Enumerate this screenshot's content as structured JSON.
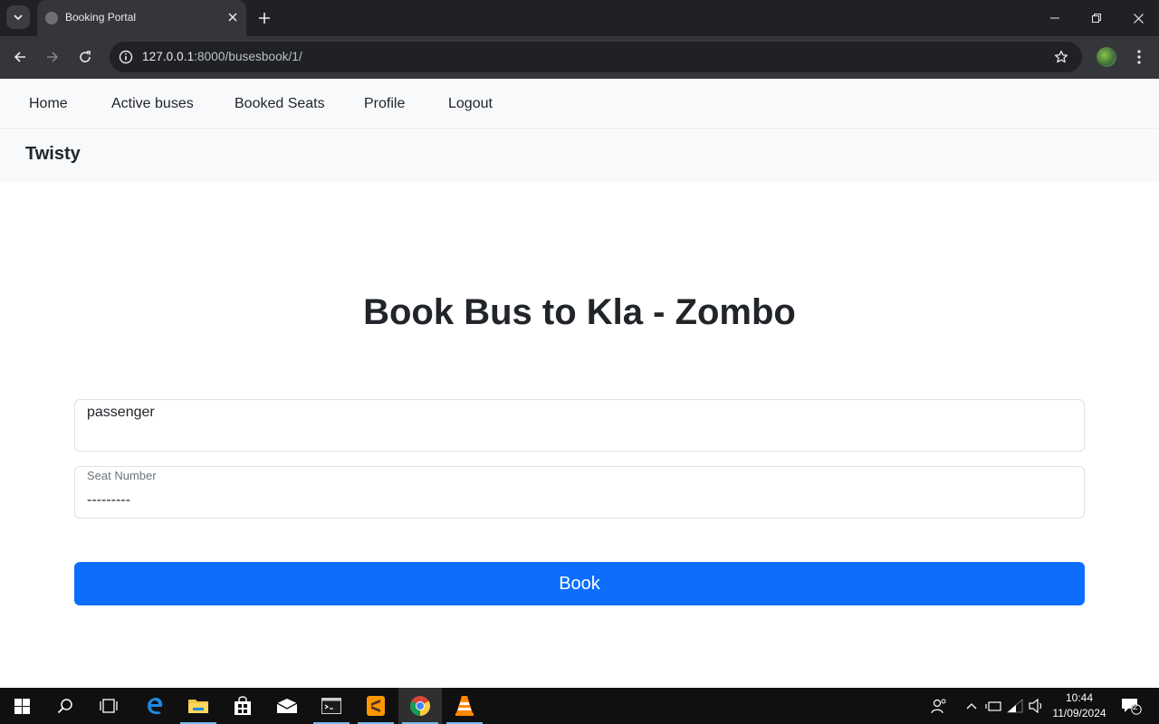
{
  "browser": {
    "tab_title": "Booking Portal",
    "url_host": "127.0.0.1",
    "url_rest": ":8000/busesbook/1/"
  },
  "nav": {
    "links": [
      "Home",
      "Active buses",
      "Booked Seats",
      "Profile",
      "Logout"
    ]
  },
  "brand": "Twisty",
  "main": {
    "heading": "Book Bus to Kla - Zombo",
    "passenger_value": "passenger",
    "seat_label": "Seat Number",
    "seat_value": "---------",
    "book_button": "Book"
  },
  "taskbar": {
    "time": "10:44",
    "date": "11/09/2024",
    "notification_count": "2"
  },
  "colors": {
    "primary": "#0d6efd",
    "navbar_bg": "#f8f9fa",
    "chrome_dark": "#202124"
  }
}
